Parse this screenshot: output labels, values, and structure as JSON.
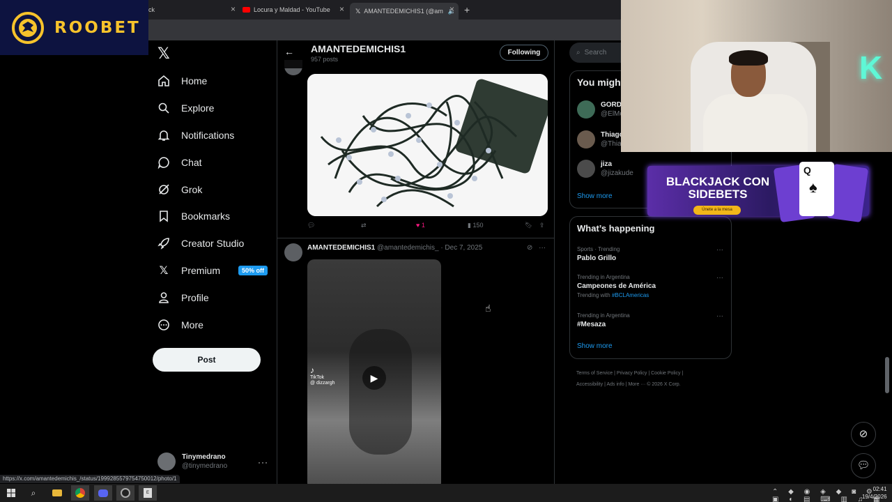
{
  "browser": {
    "tabs": [
      {
        "label": "ck"
      },
      {
        "label": "Locura y Maldad - YouTube"
      },
      {
        "label": "AMANTEDEMICHIS1 (@am"
      }
    ],
    "new_tab": "+",
    "close": "×",
    "status_url": "https://x.com/amantedemichis_/status/1999285579754750012/photo/1"
  },
  "overlay": {
    "brand": "ROOBET",
    "banner_title": "BLACKJACK CON SIDEBETS",
    "banner_cta": "Únete a la mesa",
    "card_rank": "Q"
  },
  "nav": {
    "items": [
      {
        "label": "Home",
        "icon": "home-icon"
      },
      {
        "label": "Explore",
        "icon": "search-icon"
      },
      {
        "label": "Notifications",
        "icon": "bell-icon"
      },
      {
        "label": "Chat",
        "icon": "chat-icon"
      },
      {
        "label": "Grok",
        "icon": "grok-icon"
      },
      {
        "label": "Bookmarks",
        "icon": "bookmark-icon"
      },
      {
        "label": "Creator Studio",
        "icon": "rocket-icon"
      },
      {
        "label": "Premium",
        "icon": "x-icon"
      },
      {
        "label": "Profile",
        "icon": "person-icon"
      },
      {
        "label": "More",
        "icon": "more-circle-icon"
      }
    ],
    "premium_badge": "50% off",
    "post_button": "Post",
    "user": {
      "name": "Tinymedrano",
      "handle": "@tinymedrano"
    }
  },
  "profile_header": {
    "name": "AMANTEDEMICHIS1",
    "posts": "957 posts",
    "follow_state": "Following"
  },
  "tweets": [
    {
      "likes": "1",
      "views": "150"
    },
    {
      "name": "AMANTEDEMICHIS1",
      "handle": "@amantedemichis_",
      "date": "· Dec 7, 2025",
      "video_badge": "TikTok",
      "video_user": "@ dizzargh"
    }
  ],
  "sidebar": {
    "search_placeholder": "Search",
    "who_to_follow_title": "You might",
    "suggestions": [
      {
        "name": "GORDI",
        "handle": "@ElMo"
      },
      {
        "name": "Thiago",
        "handle": "@Thiag"
      },
      {
        "name": "jiza",
        "handle": "@jizakude"
      }
    ],
    "show_more": "Show more",
    "happening_title": "What’s happening",
    "trends": [
      {
        "context": "Sports · Trending",
        "name": "Pablo Grillo",
        "sub_prefix": "",
        "sub_tag": ""
      },
      {
        "context": "Trending in Argentina",
        "name": "Campeones de América",
        "sub_prefix": "Trending with ",
        "sub_tag": "#BCLAmericas"
      },
      {
        "context": "Trending in Argentina",
        "name": "#Mesaza",
        "sub_prefix": "",
        "sub_tag": ""
      }
    ],
    "trends_show_more": "Show more",
    "footer_line1": "Terms of Service  |  Privacy Policy  |  Cookie Policy  |",
    "footer_line2": "Accessibility  |  Ads info  |  More ···  © 2026 X Corp."
  },
  "taskbar": {
    "time": "02:41",
    "date": "19/4/2026"
  }
}
